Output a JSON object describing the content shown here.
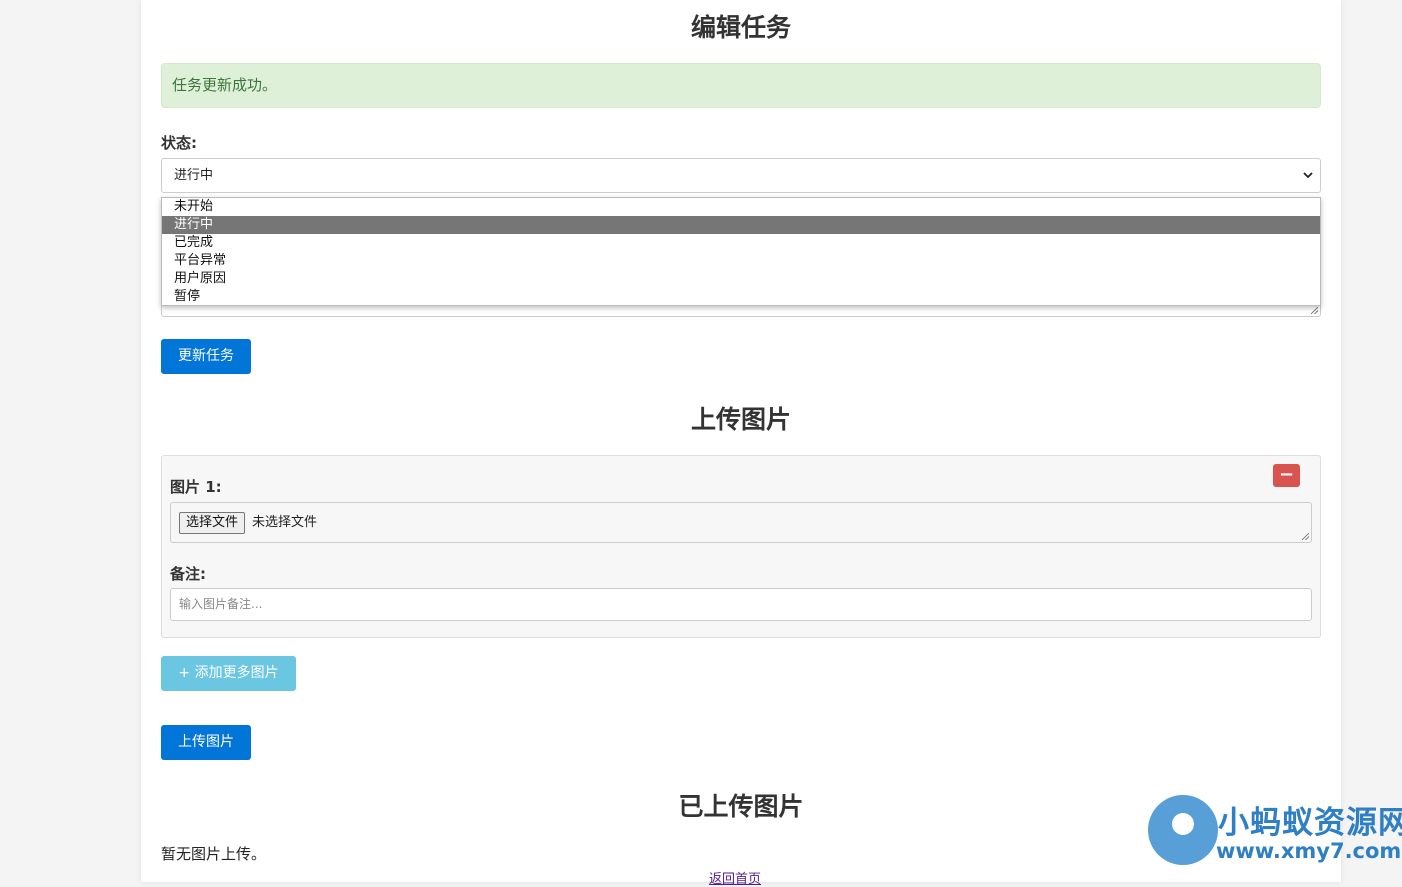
{
  "edit_section": {
    "title": "编辑任务",
    "alert": "任务更新成功。",
    "status_label": "状态:",
    "status_selected": "进行中",
    "status_options": [
      "未开始",
      "进行中",
      "已完成",
      "平台异常",
      "用户原因",
      "暂停"
    ],
    "update_button": "更新任务"
  },
  "upload_section": {
    "title": "上传图片",
    "image_label": "图片 1:",
    "remove_symbol": "−",
    "file_button": "选择文件",
    "file_status": "未选择文件",
    "note_label": "备注:",
    "note_placeholder": "输入图片备注...",
    "add_more_button": "+ 添加更多图片",
    "upload_button": "上传图片"
  },
  "uploaded_section": {
    "title": "已上传图片",
    "empty_text": "暂无图片上传。"
  },
  "footer": {
    "back_link": "返回首页"
  },
  "watermark": {
    "title": "小蚂蚁资源网",
    "url": "www.xmy7.com"
  },
  "colors": {
    "primary": "#0275d8",
    "info": "#5bc0de",
    "danger": "#d9534f",
    "success_bg": "#dff0d8",
    "success_text": "#3c763d"
  }
}
